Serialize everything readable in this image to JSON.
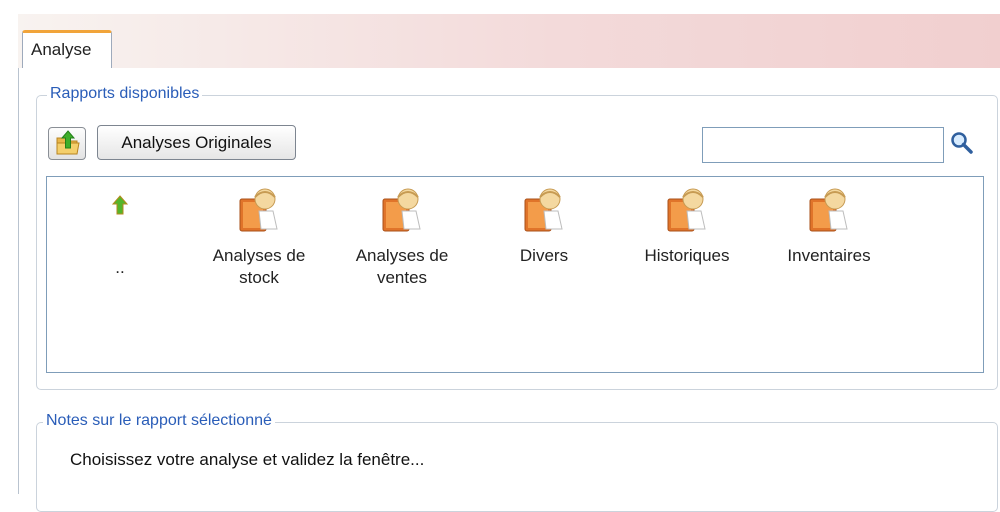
{
  "tabs": [
    {
      "label": "Analyse",
      "active": true
    }
  ],
  "reports_group": {
    "legend": "Rapports disponibles",
    "up_button_icon": "folder-up-icon",
    "originals_button_label": "Analyses Originales",
    "search": {
      "value": "",
      "placeholder": ""
    },
    "search_icon": "magnifier-icon",
    "items": [
      {
        "label": "..",
        "icon": "up-arrow-icon"
      },
      {
        "label": "Analyses de stock",
        "icon": "report-folder-icon"
      },
      {
        "label": "Analyses de ventes",
        "icon": "report-folder-icon"
      },
      {
        "label": "Divers",
        "icon": "report-folder-icon"
      },
      {
        "label": "Historiques",
        "icon": "report-folder-icon"
      },
      {
        "label": "Inventaires",
        "icon": "report-folder-icon"
      }
    ]
  },
  "notes_group": {
    "legend": "Notes sur le rapport sélectionné",
    "text": "Choisissez votre analyse et validez la fenêtre..."
  },
  "colors": {
    "tab_accent": "#f1a43a",
    "legend_text": "#2a5db8",
    "frame_border": "#7f9db9"
  }
}
